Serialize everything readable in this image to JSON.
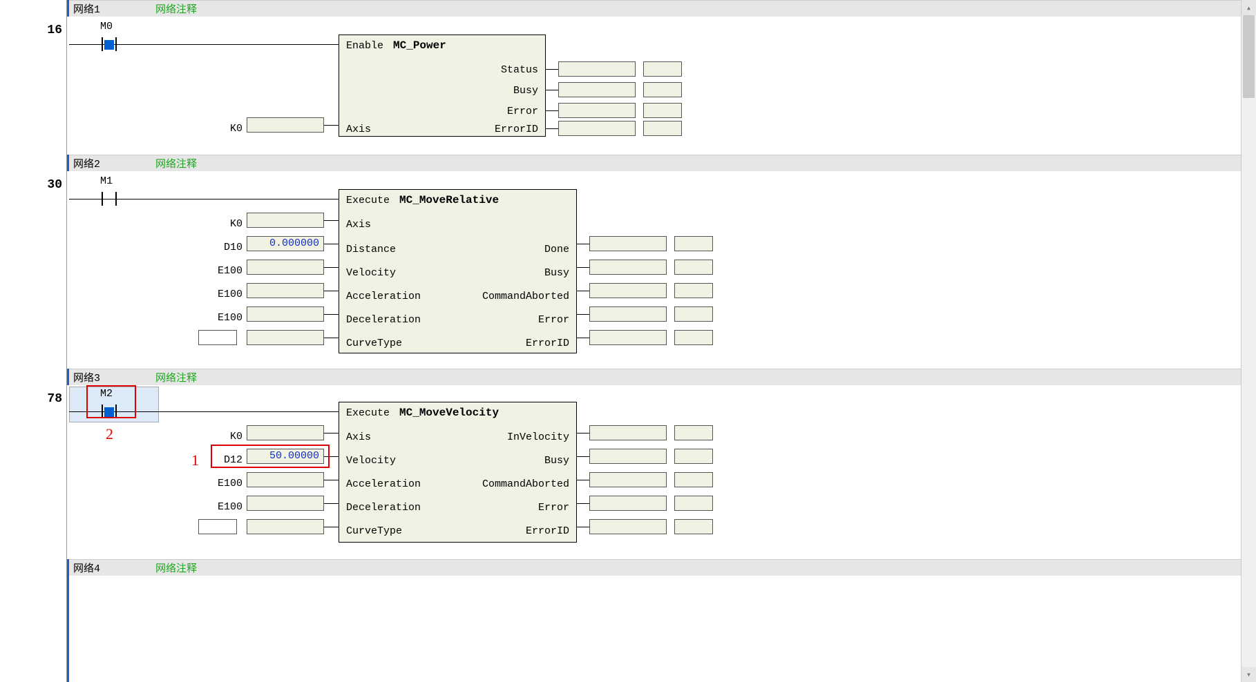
{
  "gutter": {
    "n1": "16",
    "n2": "30",
    "n3": "78"
  },
  "headers": {
    "net1": {
      "label": "网络1",
      "comment": "网络注释"
    },
    "net2": {
      "label": "网络2",
      "comment": "网络注释"
    },
    "net3": {
      "label": "网络3",
      "comment": "网络注释"
    },
    "net4": {
      "label": "网络4",
      "comment": "网络注释"
    }
  },
  "contacts": {
    "m0": "M0",
    "m1": "M1",
    "m2": "M2"
  },
  "annotations": {
    "a1": "1",
    "a2": "2"
  },
  "block1": {
    "name": "MC_Power",
    "en": "Enable",
    "inputs": {
      "axis": "Axis"
    },
    "outputs": {
      "status": "Status",
      "busy": "Busy",
      "error": "Error",
      "errorid": "ErrorID"
    },
    "in_params": {
      "k0": "K0"
    }
  },
  "block2": {
    "name": "MC_MoveRelative",
    "en": "Execute",
    "inputs": {
      "axis": "Axis",
      "distance": "Distance",
      "velocity": "Velocity",
      "accel": "Acceleration",
      "decel": "Deceleration",
      "curve": "CurveType"
    },
    "outputs": {
      "done": "Done",
      "busy": "Busy",
      "cmda": "CommandAborted",
      "error": "Error",
      "errorid": "ErrorID"
    },
    "in_params": {
      "k0": "K0",
      "d10": "D10",
      "d10v": "0.000000",
      "e100a": "E100",
      "e100b": "E100",
      "e100c": "E100"
    }
  },
  "block3": {
    "name": "MC_MoveVelocity",
    "en": "Execute",
    "inputs": {
      "axis": "Axis",
      "velocity": "Velocity",
      "accel": "Acceleration",
      "decel": "Deceleration",
      "curve": "CurveType"
    },
    "outputs": {
      "invel": "InVelocity",
      "busy": "Busy",
      "cmda": "CommandAborted",
      "error": "Error",
      "errorid": "ErrorID"
    },
    "in_params": {
      "k0": "K0",
      "d12": "D12",
      "d12v": "50.00000",
      "e100a": "E100",
      "e100b": "E100"
    }
  }
}
